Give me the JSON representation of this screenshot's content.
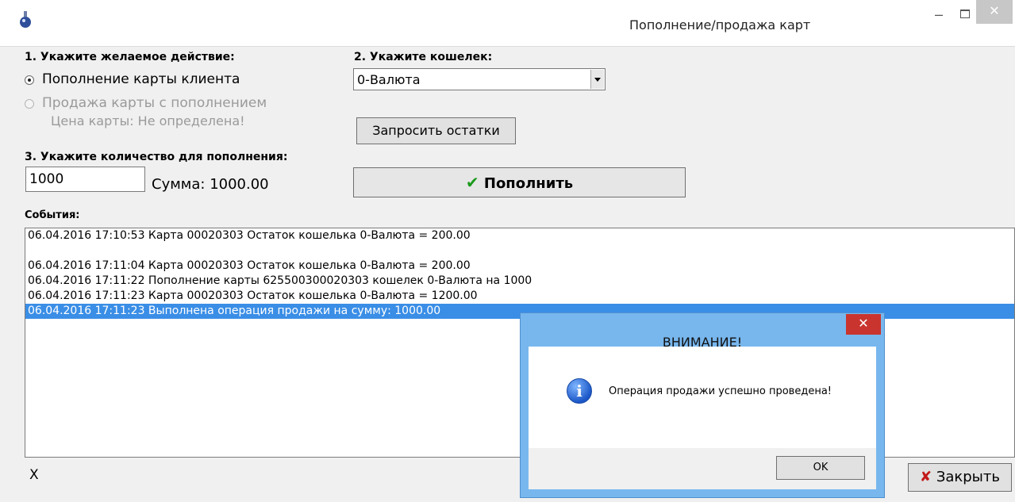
{
  "window": {
    "title": "Пополнение/продажа карт",
    "min": "–",
    "close": "✕"
  },
  "step1": {
    "label": "1. Укажите желаемое действие:",
    "option_refill": "Пополнение карты клиента",
    "option_sell": "Продажа карты с пополнением",
    "card_price": "Цена карты: Не определена!"
  },
  "step2": {
    "label": "2. Укажите кошелек:",
    "wallet_value": "0-Валюта",
    "query_button": "Запросить остатки"
  },
  "step3": {
    "label": "3. Укажите количество для пополнения:",
    "quantity": "1000",
    "sum": "Сумма: 1000.00"
  },
  "topup_button": {
    "icon": "✔",
    "label": "Пополнить"
  },
  "events": {
    "label": "События:",
    "lines": [
      "06.04.2016 17:10:53 Карта 00020303 Остаток кошелька 0-Валюта = 200.00",
      "",
      "06.04.2016 17:11:04 Карта 00020303 Остаток кошелька 0-Валюта = 200.00",
      "06.04.2016 17:11:22 Пополнение карты 625500300020303 кошелек 0-Валюта на 1000",
      "06.04.2016 17:11:23 Карта 00020303 Остаток кошелька 0-Валюта = 1200.00",
      "06.04.2016 17:11:23 Выполнена операция продажи на сумму: 1000.00"
    ],
    "selected_index": 5
  },
  "footer": {
    "status": "X",
    "close_icon": "✘",
    "close_label": "Закрыть"
  },
  "dialog": {
    "title": "ВНИМАНИЕ!",
    "close": "✕",
    "icon": "i",
    "message": "Операция продажи успешно проведена!",
    "ok_label": "OK"
  },
  "colors": {
    "selection": "#3a8ee6",
    "dialog_frame": "#78b7ee",
    "dialog_close": "#c9352e",
    "check_green": "#1b9a1b",
    "close_red": "#c21818"
  }
}
